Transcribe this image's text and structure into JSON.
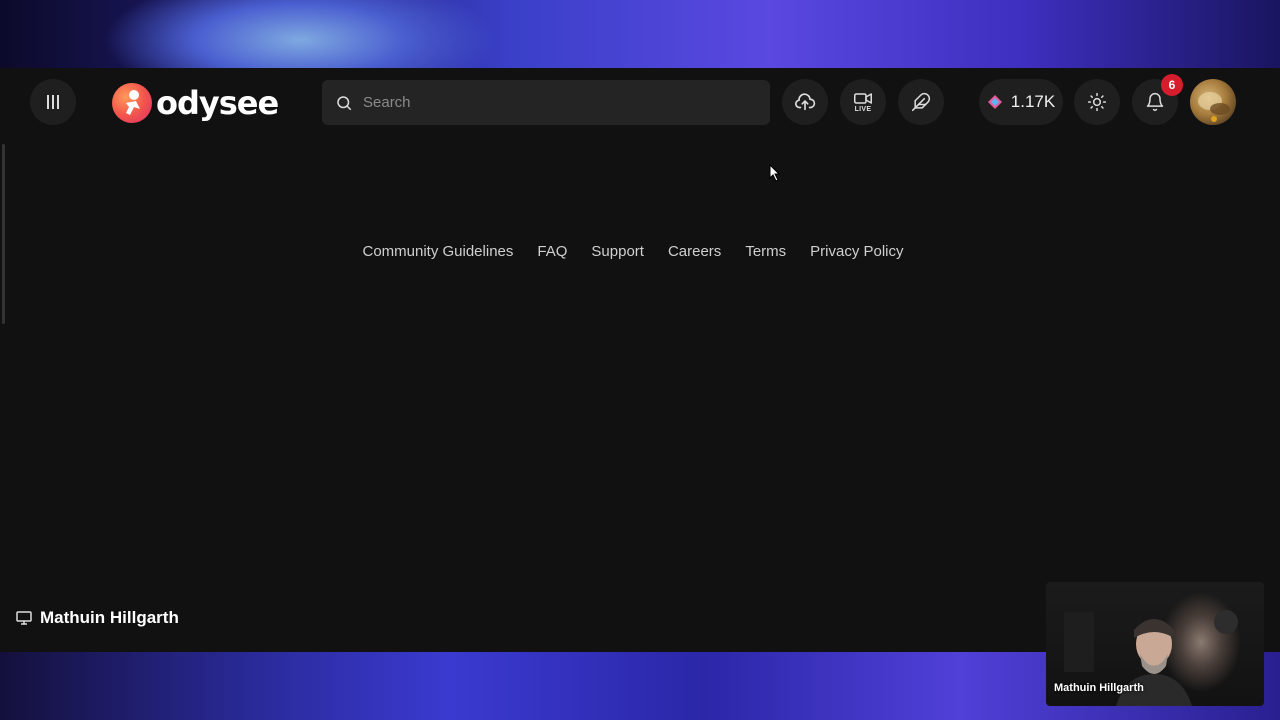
{
  "header": {
    "brand": "odysee",
    "search_placeholder": "Search",
    "live_label": "LIVE",
    "credits_balance": "1.17K",
    "notification_count": "6"
  },
  "footer": {
    "links": [
      "Community Guidelines",
      "FAQ",
      "Support",
      "Careers",
      "Terms",
      "Privacy Policy"
    ]
  },
  "screen_share": {
    "presenter_label": "Mathuin Hillgarth"
  },
  "webcam": {
    "name": "Mathuin Hillgarth"
  },
  "colors": {
    "app_background": "#111111",
    "notification_badge": "#d61d2d",
    "brand_gradient": [
      "#ff9a5a",
      "#e02c6a"
    ]
  }
}
